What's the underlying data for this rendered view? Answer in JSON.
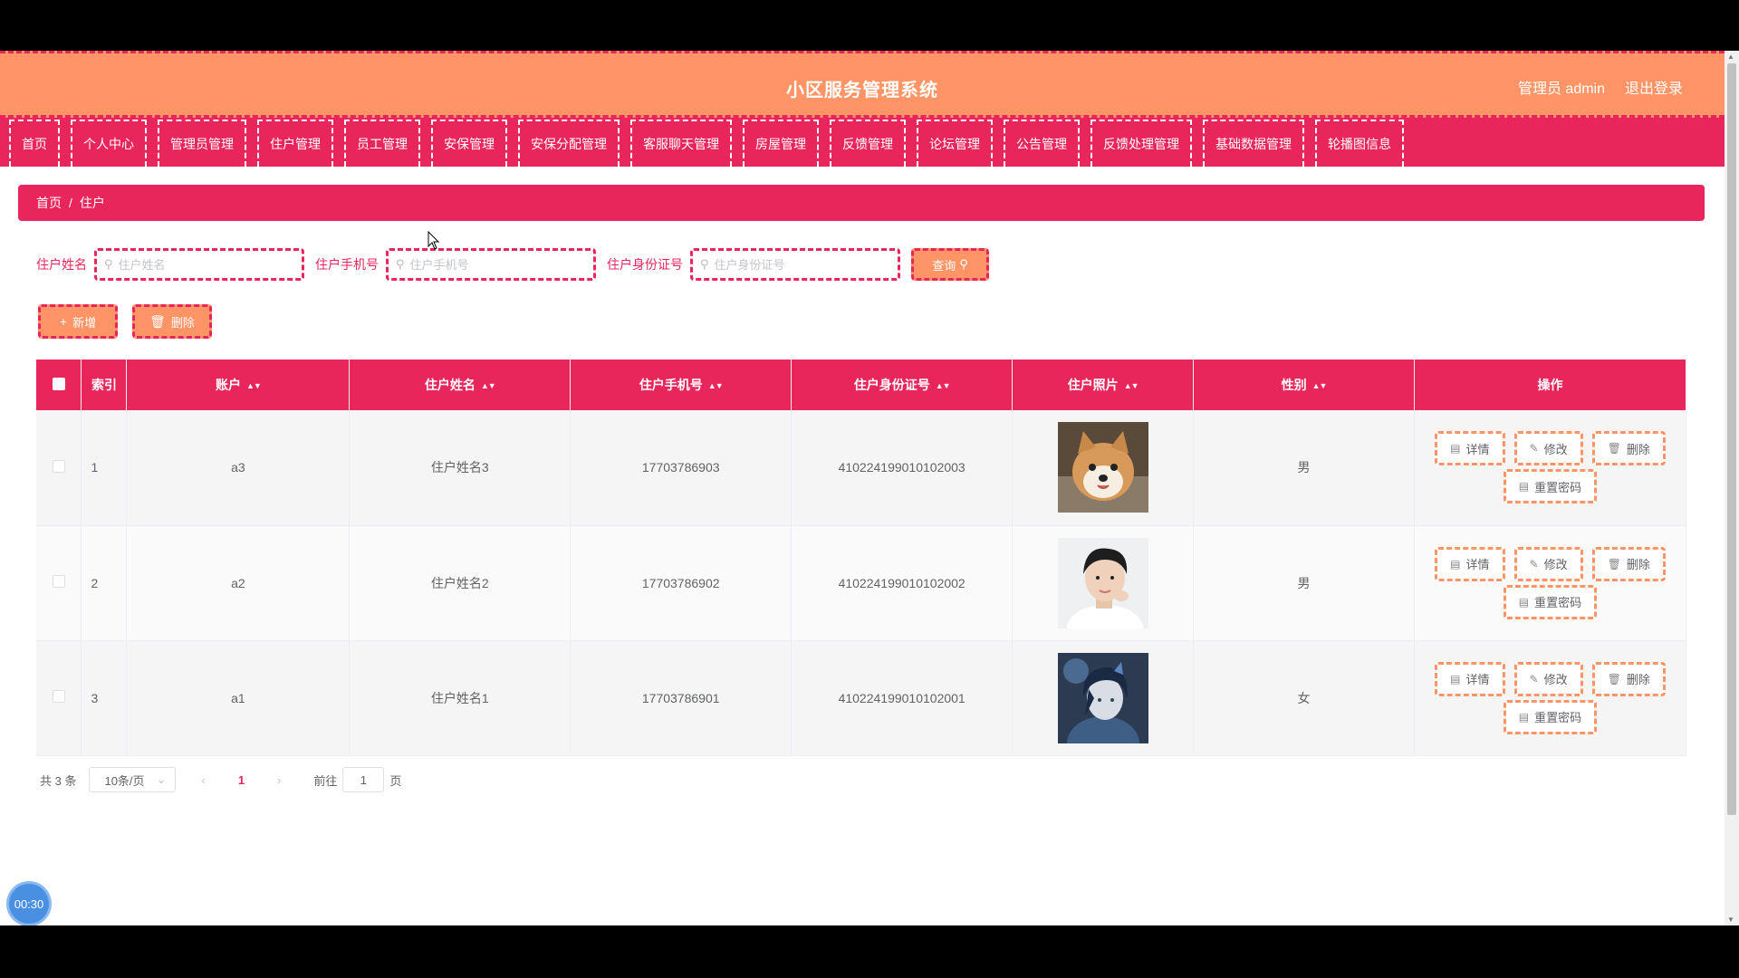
{
  "header": {
    "title": "小区服务管理系统",
    "user_label": "管理员 admin",
    "logout_label": "退出登录"
  },
  "nav": {
    "items": [
      "首页",
      "个人中心",
      "管理员管理",
      "住户管理",
      "员工管理",
      "安保管理",
      "安保分配管理",
      "客服聊天管理",
      "房屋管理",
      "反馈管理",
      "论坛管理",
      "公告管理",
      "反馈处理管理",
      "基础数据管理",
      "轮播图信息"
    ]
  },
  "breadcrumb": {
    "home": "首页",
    "separator": "/",
    "current": "住户"
  },
  "search": {
    "name_label": "住户姓名",
    "name_placeholder": "住户姓名",
    "phone_label": "住户手机号",
    "phone_placeholder": "住户手机号",
    "id_label": "住户身份证号",
    "id_placeholder": "住户身份证号",
    "query_label": "查询"
  },
  "actions": {
    "add_label": "新增",
    "delete_label": "删除"
  },
  "table": {
    "headers": [
      "索引",
      "账户",
      "住户姓名",
      "住户手机号",
      "住户身份证号",
      "住户照片",
      "性别",
      "操作"
    ],
    "rows": [
      {
        "index": "1",
        "account": "a3",
        "name": "住户姓名3",
        "phone": "17703786903",
        "id_number": "410224199010102003",
        "photo": "shiba-dog-photo",
        "gender": "男"
      },
      {
        "index": "2",
        "account": "a2",
        "name": "住户姓名2",
        "phone": "17703786902",
        "id_number": "410224199010102002",
        "photo": "young-man-portrait",
        "gender": "男"
      },
      {
        "index": "3",
        "account": "a1",
        "name": "住户姓名1",
        "phone": "17703786901",
        "id_number": "410224199010102001",
        "photo": "anime-illustration",
        "gender": "女"
      }
    ],
    "row_actions": {
      "detail": "详情",
      "edit": "修改",
      "delete": "删除",
      "reset_password": "重置密码"
    }
  },
  "pagination": {
    "total_label": "共 3 条",
    "page_size": "10条/页",
    "current_page": "1",
    "goto_prefix": "前往",
    "goto_value": "1",
    "goto_suffix": "页"
  },
  "timer": "00:30",
  "colors": {
    "primary": "#e8265c",
    "accent": "#ff9466"
  }
}
